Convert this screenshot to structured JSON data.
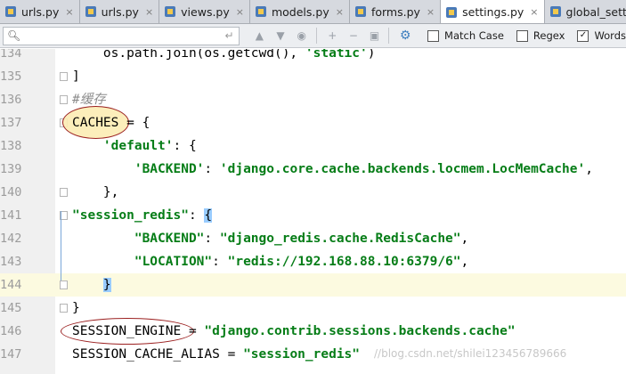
{
  "tabs": [
    {
      "label": "urls.py",
      "active": false
    },
    {
      "label": "urls.py",
      "active": false
    },
    {
      "label": "views.py",
      "active": false
    },
    {
      "label": "models.py",
      "active": false
    },
    {
      "label": "forms.py",
      "active": false
    },
    {
      "label": "settings.py",
      "active": true
    },
    {
      "label": "global_settings",
      "active": false
    }
  ],
  "tab_close_glyph": "×",
  "search": {
    "value": "",
    "placeholder": "",
    "options": [
      {
        "label": "Match Case",
        "checked": false
      },
      {
        "label": "Regex",
        "checked": false
      },
      {
        "label": "Words",
        "checked": true
      }
    ]
  },
  "editor": {
    "lines": [
      {
        "number": "134",
        "code": "    os.path.join(os.getcwd(), 'static')"
      },
      {
        "number": "135",
        "code": "]"
      },
      {
        "number": "136",
        "code": "#缓存"
      },
      {
        "number": "137",
        "code": "CACHES = {"
      },
      {
        "number": "138",
        "code": "    'default': {"
      },
      {
        "number": "139",
        "code": "        'BACKEND': 'django.core.cache.backends.locmem.LocMemCache',"
      },
      {
        "number": "140",
        "code": "    },"
      },
      {
        "number": "141",
        "code": "\"session_redis\": {"
      },
      {
        "number": "142",
        "code": "        \"BACKEND\": \"django_redis.cache.RedisCache\","
      },
      {
        "number": "143",
        "code": "        \"LOCATION\": \"redis://192.168.88.10:6379/6\","
      },
      {
        "number": "144",
        "code": "    }"
      },
      {
        "number": "145",
        "code": "}"
      },
      {
        "number": "146",
        "code": "SESSION_ENGINE = \"django.contrib.sessions.backends.cache\""
      },
      {
        "number": "147",
        "code": "SESSION_CACHE_ALIAS = \"session_redis\""
      }
    ],
    "current_line": "144",
    "watermark": "//blog.csdn.net/shilei123456789666"
  },
  "colors": {
    "string": "#067d17",
    "comment": "#8c8c8c",
    "line_number": "#9c9c9c",
    "current_line_bg": "#fcfae0",
    "annotation": "#9b2020"
  },
  "icons": {
    "search": "search-icon",
    "enter": "enter-icon",
    "up": "arrow-up-icon",
    "down": "arrow-down-icon",
    "find-all": "find-all-icon",
    "add-occurrence": "add-occurrence-icon",
    "remove-occurrence": "remove-occurrence-icon",
    "select-all": "select-all-occurrences-icon",
    "settings": "gear-icon"
  }
}
